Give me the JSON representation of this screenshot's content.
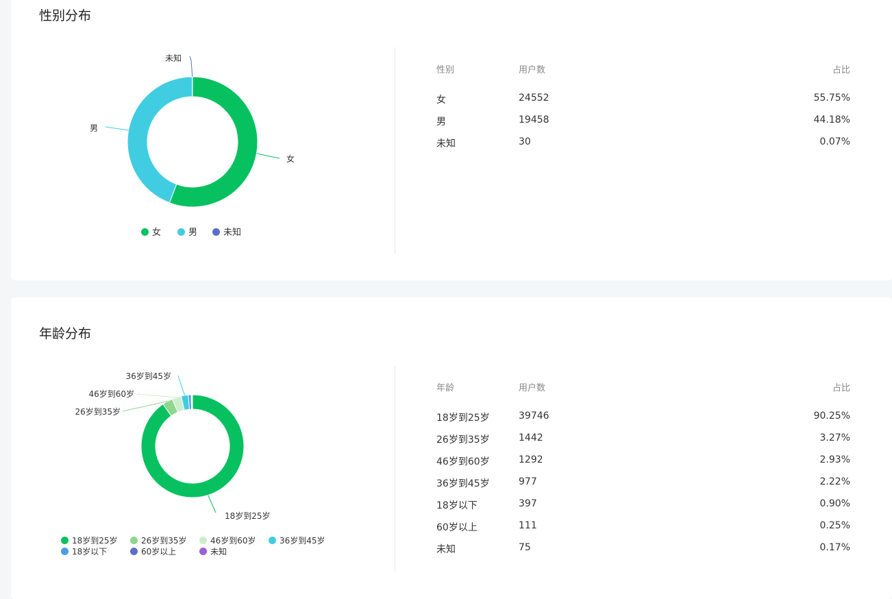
{
  "gender": {
    "title": "性别分布",
    "table": {
      "headers": [
        "性别",
        "用户数",
        "占比"
      ],
      "rows": [
        {
          "label": "女",
          "count": "24552",
          "pct": "55.75%"
        },
        {
          "label": "男",
          "count": "19458",
          "pct": "44.18%"
        },
        {
          "label": "未知",
          "count": "30",
          "pct": "0.07%"
        }
      ]
    },
    "legend": [
      "女",
      "男",
      "未知"
    ]
  },
  "age": {
    "title": "年龄分布",
    "table": {
      "headers": [
        "年龄",
        "用户数",
        "占比"
      ],
      "rows": [
        {
          "label": "18岁到25岁",
          "count": "39746",
          "pct": "90.25%"
        },
        {
          "label": "26岁到35岁",
          "count": "1442",
          "pct": "3.27%"
        },
        {
          "label": "46岁到60岁",
          "count": "1292",
          "pct": "2.93%"
        },
        {
          "label": "36岁到45岁",
          "count": "977",
          "pct": "2.22%"
        },
        {
          "label": "18岁以下",
          "count": "397",
          "pct": "0.90%"
        },
        {
          "label": "60岁以上",
          "count": "111",
          "pct": "0.25%"
        },
        {
          "label": "未知",
          "count": "75",
          "pct": "0.17%"
        }
      ]
    },
    "legend": [
      "18岁到25岁",
      "26岁到35岁",
      "46岁到60岁",
      "36岁到45岁",
      "18岁以下",
      "60岁以上",
      "未知"
    ]
  },
  "chart_data": [
    {
      "type": "pie",
      "categories": [
        "女",
        "男",
        "未知"
      ],
      "values": [
        24552,
        19458,
        30
      ],
      "colors": [
        "#07c160",
        "#40cde2",
        "#5b6fc9"
      ]
    },
    {
      "type": "pie",
      "categories": [
        "18岁到25岁",
        "26岁到35岁",
        "46岁到60岁",
        "36岁到45岁",
        "18岁以下",
        "60岁以上",
        "未知"
      ],
      "values": [
        39746,
        1442,
        1292,
        977,
        397,
        111,
        75
      ],
      "colors": [
        "#07c160",
        "#8fd68f",
        "#cdeecd",
        "#40cde2",
        "#4b9ee6",
        "#5b6fc9",
        "#9b5fd8"
      ]
    }
  ]
}
